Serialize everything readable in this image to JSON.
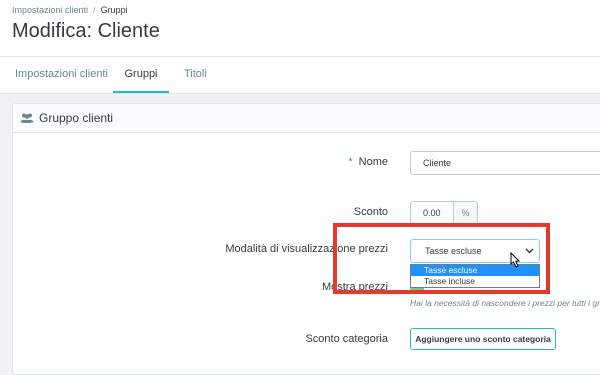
{
  "breadcrumb": {
    "parent": "Impostazioni clienti",
    "separator": "/",
    "current": "Gruppi"
  },
  "page_title": "Modifica: Cliente",
  "tabs": [
    {
      "label": "Impostazioni clienti"
    },
    {
      "label": "Gruppi",
      "active": true
    },
    {
      "label": "Titoli"
    }
  ],
  "panel": {
    "title": "Gruppo clienti",
    "icon": "users-icon",
    "form": {
      "name": {
        "required_marker": "*",
        "label": "Nome",
        "value": "Cliente"
      },
      "discount": {
        "label": "Sconto",
        "value": "0.00",
        "addon": "%"
      },
      "price_display": {
        "label": "Modalità di visualizzazione prezzi",
        "selected": "Tasse escluse",
        "options": [
          "Tasse escluse",
          "Tasse incluse"
        ]
      },
      "show_prices": {
        "label": "Mostra prezzi",
        "help": "Hai la necessità di nascondere i prezzi per tutti i gruppi"
      },
      "category_discount": {
        "label": "Sconto categoria",
        "button": "Aggiungere uno sconto categoria"
      }
    }
  },
  "colors": {
    "accent": "#25b9d7",
    "highlight": "#e23a2f",
    "option_selected": "#1e90ff",
    "switch_on": "#78d07d"
  }
}
